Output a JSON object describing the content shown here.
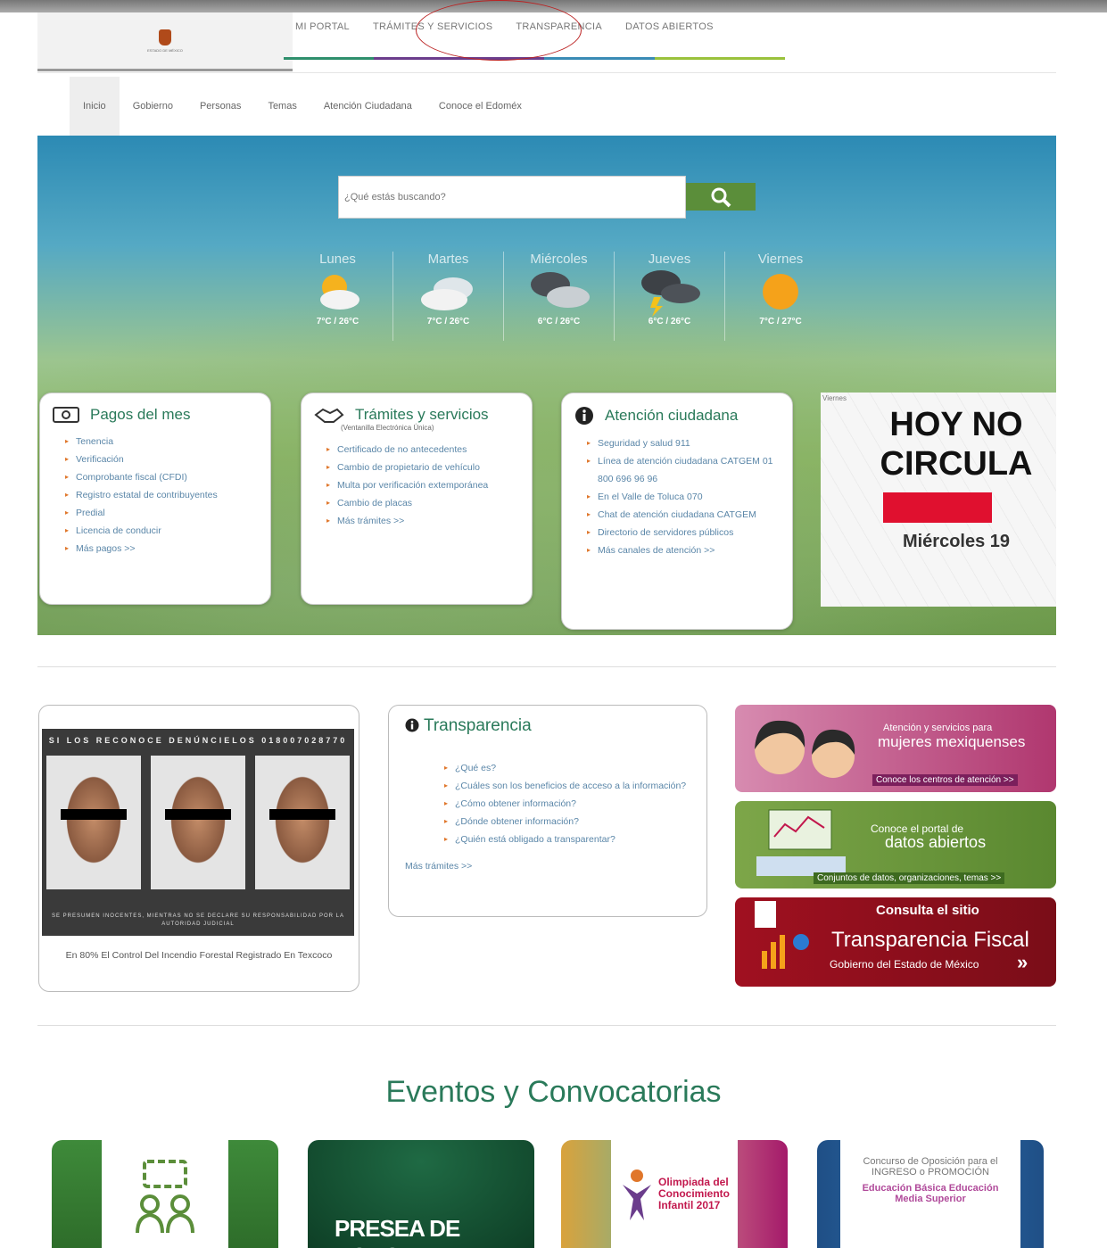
{
  "logo": {
    "text": "ESTADO DE MÉXICO"
  },
  "top_nav": [
    "MI PORTAL",
    "TRÁMITES Y SERVICIOS",
    "TRANSPARENCIA",
    "DATOS ABIERTOS"
  ],
  "sub_nav": [
    "Inicio",
    "Gobierno",
    "Personas",
    "Temas",
    "Atención Ciudadana",
    "Conoce el Edoméx"
  ],
  "search": {
    "placeholder": "¿Qué estás buscando?"
  },
  "weather": [
    {
      "day": "Lunes",
      "temp": "7°C / 26°C",
      "icon": "partly-cloudy-icon"
    },
    {
      "day": "Martes",
      "temp": "7°C / 26°C",
      "icon": "cloudy-icon"
    },
    {
      "day": "Miércoles",
      "temp": "6°C / 26°C",
      "icon": "rain-cloud-icon"
    },
    {
      "day": "Jueves",
      "temp": "6°C / 26°C",
      "icon": "storm-icon"
    },
    {
      "day": "Viernes",
      "temp": "7°C / 27°C",
      "icon": "sun-icon"
    }
  ],
  "pagos": {
    "title": "Pagos del mes",
    "items": [
      "Tenencia",
      "Verificación",
      "Comprobante fiscal (CFDI)",
      "Registro estatal de contribuyentes",
      "Predial",
      "Licencia de conducir",
      "Más pagos >>"
    ]
  },
  "tramites": {
    "title": "Trámites y servicios",
    "subtitle": "(Ventanilla Electrónica Única)",
    "items": [
      "Certificado de no antecedentes",
      "Cambio de propietario de vehículo",
      "Multa por verificación extemporánea",
      "Cambio de placas",
      "Más trámites >>"
    ]
  },
  "atencion": {
    "title": "Atención ciudadana",
    "items": [
      "Seguridad y salud 911",
      "Línea de atención ciudadana CATGEM 01 800 696 96 96",
      "En el Valle de Toluca 070",
      "Chat de atención ciudadana CATGEM",
      "Directorio de servidores públicos",
      "Más canales de atención >>"
    ]
  },
  "hoy_no_circula": {
    "tag": "Viernes",
    "line1": "HOY NO",
    "line2": "CIRCULA",
    "day": "Miércoles 19",
    "color": "#e0102f"
  },
  "wanted": {
    "header": "SI LOS RECONOCE DENÚNCIELOS 018007028770",
    "footer": "SE PRESUMEN INOCENTES, MIENTRAS NO SE DECLARE SU RESPONSABILIDAD POR LA AUTORIDAD JUDICIAL",
    "caption": "En 80% El Control Del Incendio Forestal Registrado En Texcoco"
  },
  "transparencia": {
    "title": "Transparencia",
    "items": [
      "¿Qué es?",
      "¿Cuáles son los beneficios de acceso a la información?",
      "¿Cómo obtener información?",
      "¿Dónde obtener información?",
      "¿Quién está obligado a transparentar?"
    ],
    "more": "Más trámites >>"
  },
  "banners": {
    "mujeres": {
      "line1": "Atención y servicios para",
      "line2": "mujeres mexiquenses",
      "cta": "Conoce los centros de atención >>"
    },
    "datos": {
      "line1": "Conoce el portal de",
      "line2": "datos abiertos",
      "cta": "Conjuntos de datos, organizaciones, temas >>"
    },
    "fiscal": {
      "line1": "Consulta el sitio",
      "line2": "Transparencia Fiscal",
      "line3": "Gobierno del Estado de México"
    }
  },
  "events": {
    "title": "Eventos y Convocatorias",
    "items": [
      {
        "label": ""
      },
      {
        "label": "PRESEA DE HONOR"
      },
      {
        "label": "Olimpiada del Conocimiento Infantil 2017"
      },
      {
        "label": "Concurso de Oposición para el INGRESO o PROMOCIÓN",
        "sub": "Educación Básica Educación Media Superior"
      }
    ]
  }
}
